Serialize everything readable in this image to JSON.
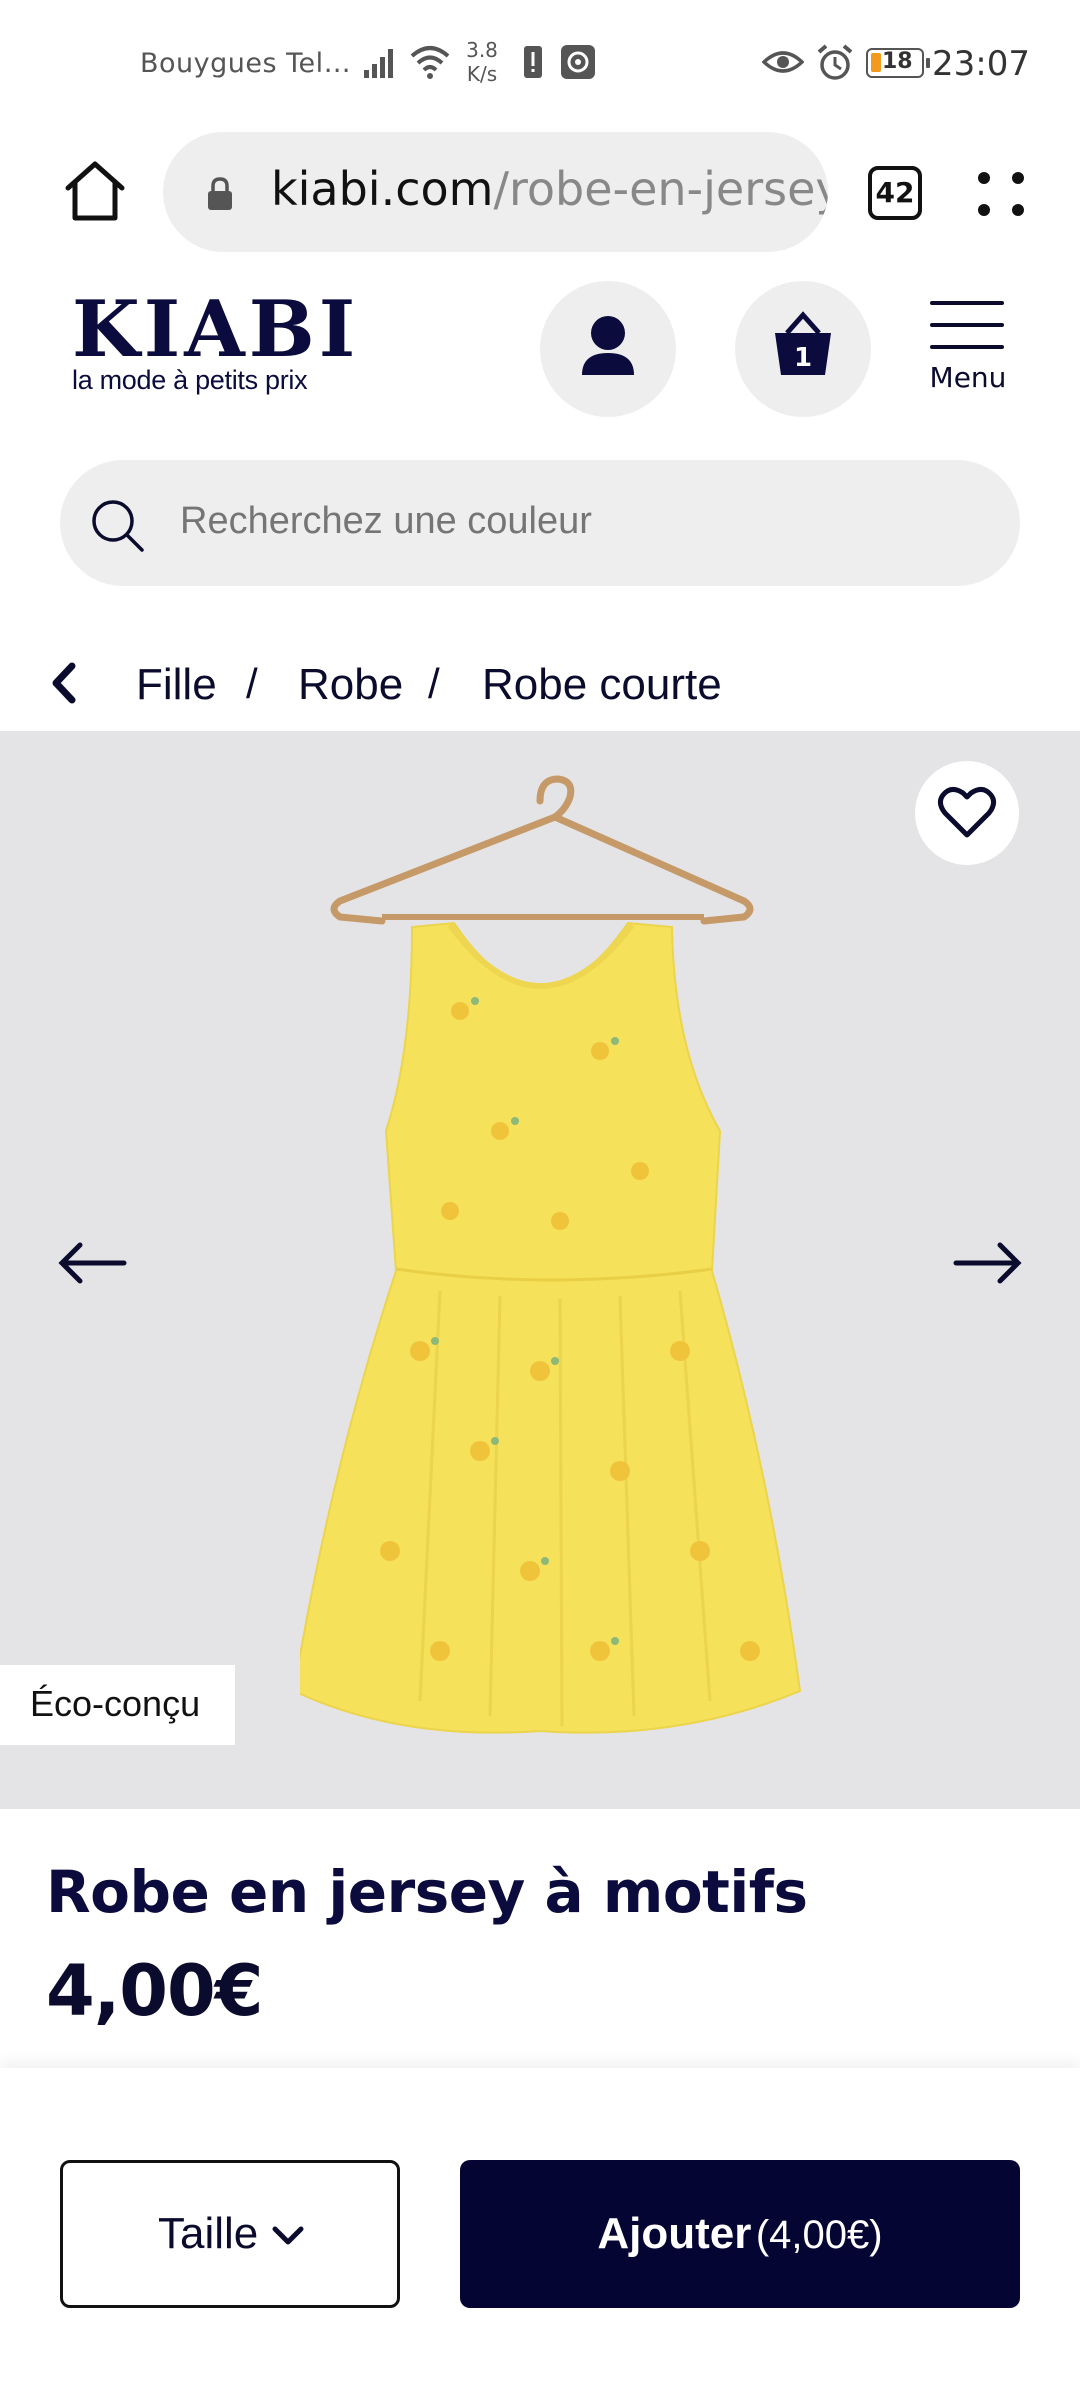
{
  "status_bar": {
    "carrier": "Bouygues Tel…",
    "net_speed_value": "3.8",
    "net_speed_unit": "K/s",
    "battery_level": "18",
    "time": "23:07"
  },
  "browser": {
    "url_host": "kiabi.com",
    "url_path": "/robe-en-jersey",
    "tab_count": "42"
  },
  "header": {
    "logo_text": "KIABI",
    "logo_tagline": "la mode à petits prix",
    "cart_count": "1",
    "menu_label": "Menu"
  },
  "search": {
    "placeholder": "Recherchez une couleur"
  },
  "breadcrumb": {
    "items": [
      "Fille",
      "Robe",
      "Robe courte"
    ],
    "separator": "/"
  },
  "product": {
    "badge": "Éco-conçu",
    "title": "Robe en jersey à motifs",
    "price": "4,00€"
  },
  "actions": {
    "size_label": "Taille",
    "add_label": "Ajouter",
    "add_price": "(4,00€)"
  },
  "colors": {
    "brand_navy": "#050533",
    "dress_yellow": "#f5e15a",
    "image_bg": "#e4e4e6"
  }
}
